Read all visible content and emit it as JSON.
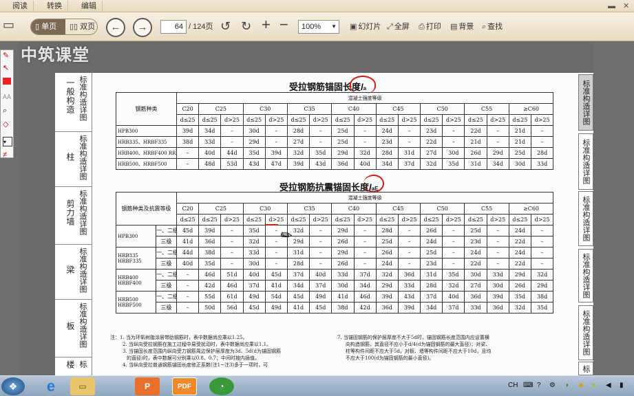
{
  "menubar": {
    "tabs": [
      "阅读",
      "转换",
      "编辑"
    ]
  },
  "toolbar": {
    "single_page": "单页",
    "double_page": "双页",
    "page_current": "64",
    "page_total": "/ 124页",
    "zoom": "100%",
    "slideshow": "幻灯片",
    "fullscreen": "全屏",
    "print": "打印",
    "background": "背景",
    "find": "查找"
  },
  "watermark": "中筑课堂",
  "left_margin": [
    {
      "big": "一般构造",
      "small": "标准构造详图"
    },
    {
      "big": "柱",
      "small": "标准构造详图"
    },
    {
      "big": "剪力墙",
      "small": "标准构造详图"
    },
    {
      "big": "梁",
      "small": "标准构造详图"
    },
    {
      "big": "板",
      "small": "标准构造详图"
    },
    {
      "big": "楼",
      "small": "标"
    }
  ],
  "right_tabs": [
    "标准构造详图",
    "标准构造详图",
    "标准构造详图",
    "标准构造详图",
    "标准构造详图",
    "标"
  ],
  "table1": {
    "title": "受拉钢筋锚固长度",
    "symbol": "l",
    "symbol_sub": "a",
    "concrete_header": "混凝土强度等级",
    "rebar_header": "钢筋种类",
    "grades": [
      "C20",
      "C25",
      "C30",
      "C35",
      "C40",
      "C45",
      "C50",
      "C55",
      "≥C60"
    ],
    "sub_cols": [
      "d≤25",
      "d≤25",
      "d>25",
      "d≤25",
      "d>25",
      "d≤25",
      "d>25",
      "d≤25",
      "d>25",
      "d≤25",
      "d>25",
      "d≤25",
      "d>25",
      "d≤25",
      "d>25",
      "d≤25",
      "d>25"
    ],
    "rows": [
      {
        "type": "HPB300",
        "values": [
          "39d",
          "34d",
          "–",
          "30d",
          "–",
          "28d",
          "–",
          "25d",
          "–",
          "24d",
          "–",
          "23d",
          "–",
          "22d",
          "–",
          "21d",
          "–"
        ]
      },
      {
        "type": "HRB335、HRBF335",
        "values": [
          "38d",
          "33d",
          "–",
          "29d",
          "–",
          "27d",
          "–",
          "25d",
          "–",
          "23d",
          "–",
          "22d",
          "–",
          "21d",
          "–",
          "21d",
          "–"
        ]
      },
      {
        "type": "HRB400、HRBF400 RRB400",
        "values": [
          "–",
          "40d",
          "44d",
          "35d",
          "39d",
          "32d",
          "35d",
          "29d",
          "32d",
          "28d",
          "31d",
          "27d",
          "30d",
          "26d",
          "29d",
          "25d",
          "28d"
        ]
      },
      {
        "type": "HRB500、HRBF500",
        "values": [
          "–",
          "48d",
          "53d",
          "43d",
          "47d",
          "39d",
          "43d",
          "36d",
          "40d",
          "34d",
          "37d",
          "32d",
          "35d",
          "31d",
          "34d",
          "30d",
          "33d"
        ]
      }
    ]
  },
  "table2": {
    "title": "受拉钢筋抗震锚固长度",
    "symbol": "l",
    "symbol_sub": "aE",
    "concrete_header": "混凝土强度等级",
    "rebar_header": "钢筋种类及抗震等级",
    "grades": [
      "C20",
      "C25",
      "C30",
      "C35",
      "C40",
      "C45",
      "C50",
      "C55",
      "≥C60"
    ],
    "sub_cols": [
      "d≤25",
      "d≤25",
      "d>25",
      "d≤25",
      "d>25",
      "d≤25",
      "d>25",
      "d≤25",
      "d>25",
      "d≤25",
      "d>25",
      "d≤25",
      "d>25",
      "d≤25",
      "d>25",
      "d≤25",
      "d>25"
    ],
    "groups": [
      {
        "type": "HPB300",
        "rows": [
          {
            "level": "一、二级",
            "values": [
              "45d",
              "39d",
              "–",
              "35d",
              "–",
              "32d",
              "–",
              "29d",
              "–",
              "28d",
              "–",
              "26d",
              "–",
              "25d",
              "–",
              "24d",
              "–"
            ]
          },
          {
            "level": "三级",
            "values": [
              "41d",
              "36d",
              "–",
              "32d",
              "–",
              "29d",
              "–",
              "26d",
              "–",
              "25d",
              "–",
              "24d",
              "–",
              "23d",
              "–",
              "22d",
              "–"
            ]
          }
        ]
      },
      {
        "type": "HRB335 HRBF335",
        "rows": [
          {
            "level": "一、二级",
            "values": [
              "44d",
              "38d",
              "–",
              "33d",
              "–",
              "31d",
              "–",
              "29d",
              "–",
              "26d",
              "–",
              "25d",
              "–",
              "24d",
              "–",
              "24d",
              "–"
            ]
          },
          {
            "level": "三级",
            "values": [
              "40d",
              "35d",
              "–",
              "30d",
              "–",
              "28d",
              "–",
              "26d",
              "–",
              "24d",
              "–",
              "23d",
              "–",
              "22d",
              "–",
              "22d",
              "–"
            ]
          }
        ]
      },
      {
        "type": "HRB400 HRBF400",
        "rows": [
          {
            "level": "一、二级",
            "values": [
              "–",
              "46d",
              "51d",
              "40d",
              "45d",
              "37d",
              "40d",
              "33d",
              "37d",
              "32d",
              "36d",
              "31d",
              "35d",
              "30d",
              "33d",
              "29d",
              "32d"
            ]
          },
          {
            "level": "三级",
            "values": [
              "–",
              "42d",
              "46d",
              "37d",
              "41d",
              "34d",
              "37d",
              "30d",
              "34d",
              "29d",
              "33d",
              "28d",
              "32d",
              "27d",
              "30d",
              "26d",
              "29d"
            ]
          }
        ]
      },
      {
        "type": "HRB500 HRBF500",
        "rows": [
          {
            "level": "一、二级",
            "values": [
              "–",
              "55d",
              "61d",
              "49d",
              "54d",
              "45d",
              "49d",
              "41d",
              "46d",
              "39d",
              "43d",
              "37d",
              "40d",
              "36d",
              "39d",
              "35d",
              "38d"
            ]
          },
          {
            "level": "三级",
            "values": [
              "–",
              "50d",
              "56d",
              "45d",
              "49d",
              "41d",
              "45d",
              "38d",
              "42d",
              "36d",
              "39d",
              "34d",
              "37d",
              "33d",
              "36d",
              "32d",
              "35d"
            ]
          }
        ]
      }
    ]
  },
  "notes_left": [
    "注：1. 当为环氧树脂涂层带肋钢筋时，表中数据尚应乘以1.25。",
    "2. 当纵向受拉钢筋在施工过程中易受扰动时，表中数据尚应乘以1.1。",
    "3. 当锚固长度范围内纵向受力钢筋周边保护层厚度为3d、5d(d为锚固钢筋",
    "的直径)时，表中数据可分别乘以0.8、0.7；中间时按内插值。",
    "4. 当纵向受拉普通钢筋锚固长度修正系数(注1~注3)多于一项时，可"
  ],
  "notes_right": [
    "7. 当锚固钢筋的保护层厚度不大于5d时，锚固钢筋长度范围内应设置横",
    "向构造钢筋，其直径不应小于d/4(d为锚固钢筋的最大直径)；对梁、",
    "柱等构件间距不应大于5d，对板、墙等构件间距不应大于10d，且均",
    "不应大于100(d为锚固钢筋的最小直径)。"
  ],
  "tray": {
    "lang": "CH"
  },
  "colors": {
    "annotation_red": "#d21818",
    "toolbar_bg": "#efe4cf"
  }
}
